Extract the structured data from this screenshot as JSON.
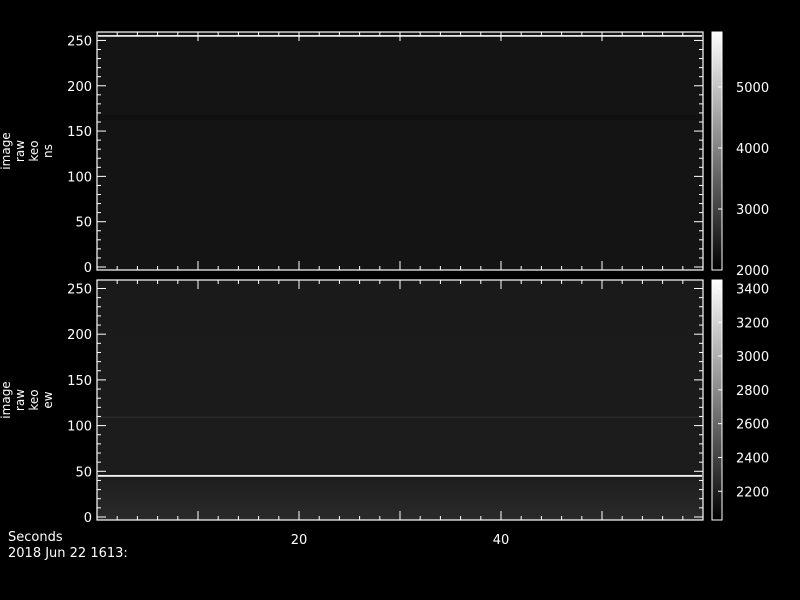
{
  "colors": {
    "background": "#000000",
    "axis": "#ffffff",
    "text": "#ffffff",
    "plot_fill_top": "#141414",
    "plot_fill_bottom": "#1c1c1c",
    "bright_line": "#e6e6e6"
  },
  "footer": {
    "x_label": "Seconds",
    "timestamp": "2018 Jun 22 1613:"
  },
  "chart_data": [
    {
      "type": "heatmap",
      "ylabel_lines": [
        "image",
        "raw",
        "keo",
        "ns"
      ],
      "ylim": [
        0,
        256
      ],
      "yticks": [
        0,
        50,
        100,
        150,
        200,
        250
      ],
      "xlim": [
        0,
        60
      ],
      "xticks": [
        20,
        40
      ],
      "x_tick_labels_shown": false,
      "colorbar": {
        "range": [
          2000,
          5900
        ],
        "ticks": [
          2000,
          3000,
          4000,
          5000
        ]
      },
      "features": [
        {
          "y_from": 162,
          "y_to": 168,
          "level": 2250
        },
        {
          "y_from": 254,
          "y_to": 256,
          "level": 5500
        }
      ]
    },
    {
      "type": "heatmap",
      "ylabel_lines": [
        "image",
        "raw",
        "keo",
        "ew"
      ],
      "ylim": [
        0,
        256
      ],
      "yticks": [
        0,
        50,
        100,
        150,
        200,
        250
      ],
      "xlim": [
        0,
        60
      ],
      "xticks": [
        20,
        40
      ],
      "x_tick_labels_shown": true,
      "colorbar": {
        "range": [
          2030,
          3450
        ],
        "ticks": [
          2200,
          2400,
          2600,
          2800,
          3000,
          3200,
          3400
        ]
      },
      "features": [
        {
          "y_from": 44,
          "y_to": 46,
          "level": 3400
        },
        {
          "y_from": 108,
          "y_to": 110,
          "level": 2250
        }
      ]
    }
  ]
}
